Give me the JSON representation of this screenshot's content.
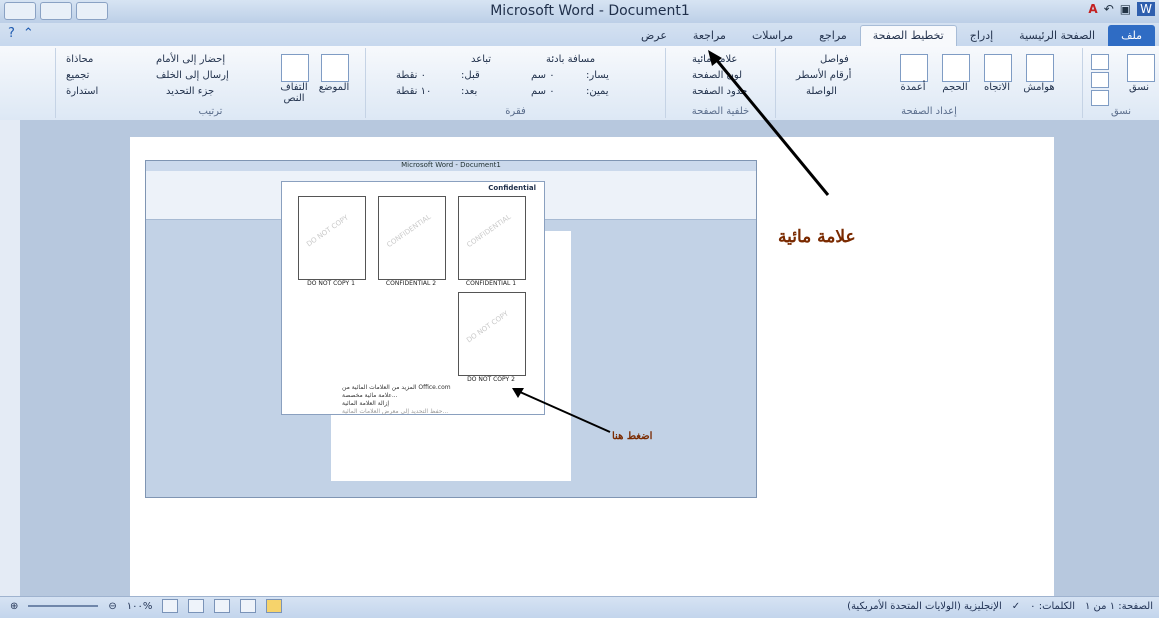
{
  "window": {
    "title": "Microsoft Word - Document1"
  },
  "tabs": [
    {
      "label": "ملف"
    },
    {
      "label": "الصفحة الرئيسية"
    },
    {
      "label": "إدراج"
    },
    {
      "label": "تخطيط الصفحة"
    },
    {
      "label": "مراجع"
    },
    {
      "label": "مراسلات"
    },
    {
      "label": "مراجعة"
    },
    {
      "label": "عرض"
    }
  ],
  "ribbon": {
    "themes": {
      "label": "نسق",
      "group": "نسق"
    },
    "setup": {
      "margins": "هوامش",
      "orientation": "الاتجاه",
      "size": "الحجم",
      "columns": "أعمدة",
      "breaks": "فواصل",
      "line_numbers": "أرقام الأسطر",
      "hyphenation": "الواصلة",
      "group": "إعداد الصفحة"
    },
    "background": {
      "watermark": "علامة مائية",
      "page_color": "لون الصفحة",
      "page_borders": "حدود الصفحة",
      "group": "خلفية الصفحة"
    },
    "paragraph": {
      "indent": "مسافة بادئة",
      "left": "يسار:",
      "left_value": "٠ سم",
      "right": "يمين:",
      "right_value": "٠ سم",
      "spacing": "تباعد",
      "before": "قبل:",
      "before_value": "٠ نقطة",
      "after": "بعد:",
      "after_value": "١٠ نقطة",
      "group": "فقرة"
    },
    "arrange": {
      "position": "الموضع",
      "wrap": "التفاف النص",
      "forward": "إحضار إلى الأمام",
      "backward": "إرسال إلى الخلف",
      "pane": "جزء التحديد",
      "align": "محاذاة",
      "group_btn": "تجميع",
      "rotate": "استدارة",
      "group": "ترتيب"
    }
  },
  "status": {
    "page": "الصفحة: ١ من ١",
    "words": "الكلمات: ٠",
    "language": "الإنجليزية (الولايات المتحدة الأمريكية)",
    "zoom": "١٠٠%"
  },
  "inner": {
    "title": "Microsoft Word - Document1",
    "thumbs": [
      {
        "caption": "CONFIDENTIAL 1",
        "mark": "CONFIDENTIAL"
      },
      {
        "caption": "CONFIDENTIAL 2",
        "mark": "CONFIDENTIAL"
      },
      {
        "caption": "DO NOT COPY 1",
        "mark": "DO NOT COPY"
      },
      {
        "caption": "DO NOT COPY 2",
        "mark": "DO NOT COPY"
      }
    ],
    "confidential_header": "Confidential",
    "menu": [
      "المزيد من العلامات المائية من Office.com",
      "علامة مائية مخصصة...",
      "إزالة العلامة المائية",
      "حفظ التحديد إلى معرض العلامات المائية..."
    ]
  },
  "callouts": {
    "watermark": "علامة مائية",
    "press_here": "اضغط هنا"
  }
}
